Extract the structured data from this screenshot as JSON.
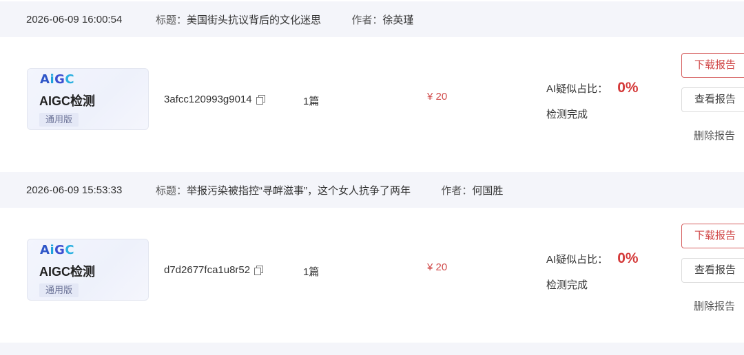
{
  "labels": {
    "title_label": "标题：",
    "author_label": "作者：",
    "ai_label": "AI疑似占比：",
    "download": "下载报告",
    "view": "查看报告",
    "delete": "删除报告"
  },
  "records": [
    {
      "time": "2026-06-09 16:00:54",
      "title": "美国街头抗议背后的文化迷思",
      "author": "徐英瑾",
      "product": {
        "logo": [
          "A",
          "i",
          "G",
          "C"
        ],
        "name": "AIGC检测",
        "edition": "通用版"
      },
      "order_id": "3afcc120993g9014",
      "count": "1篇",
      "price": "¥ 20",
      "ai_percent": "0%",
      "status": "检测完成"
    },
    {
      "time": "2026-06-09 15:53:33",
      "title": "举报污染被指控“寻衅滋事”，这个女人抗争了两年",
      "author": "何国胜",
      "product": {
        "logo": [
          "A",
          "i",
          "G",
          "C"
        ],
        "name": "AIGC检测",
        "edition": "通用版"
      },
      "order_id": "d7d2677fca1u8r52",
      "count": "1篇",
      "price": "¥ 20",
      "ai_percent": "0%",
      "status": "检测完成"
    }
  ],
  "colors": {
    "accent_red": "#d04848",
    "header_bg": "#f4f5fa"
  },
  "icons": {
    "copy": "copy-icon"
  }
}
